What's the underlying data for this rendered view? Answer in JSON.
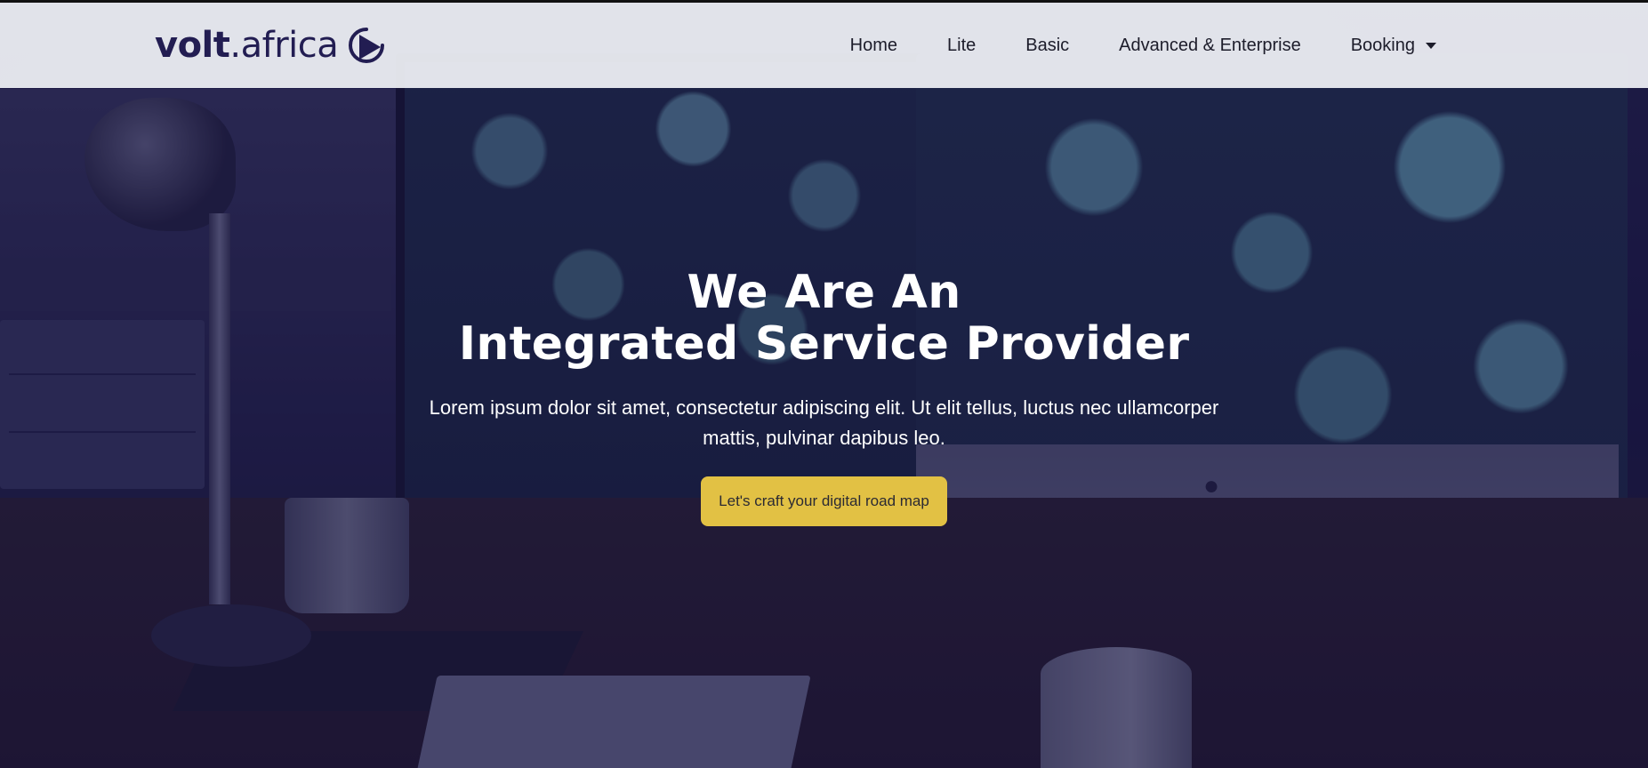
{
  "brand": {
    "name_bold": "volt",
    "name_light": ".africa",
    "color": "#221d52"
  },
  "nav": {
    "items": [
      {
        "label": "Home"
      },
      {
        "label": "Lite"
      },
      {
        "label": "Basic"
      },
      {
        "label": "Advanced & Enterprise"
      },
      {
        "label": "Booking",
        "has_dropdown": true,
        "icon": "caret-down-icon"
      }
    ]
  },
  "hero": {
    "title_line1": "We Are An",
    "title_line2": "Integrated Service Provider",
    "subtitle": "Lorem ipsum dolor sit amet, consectetur adipiscing elit. Ut elit tellus, luctus nec ullamcorper mattis, pulvinar dapibus leo.",
    "cta_label": "Let's craft your digital road map",
    "cta_color": "#e2c144"
  }
}
